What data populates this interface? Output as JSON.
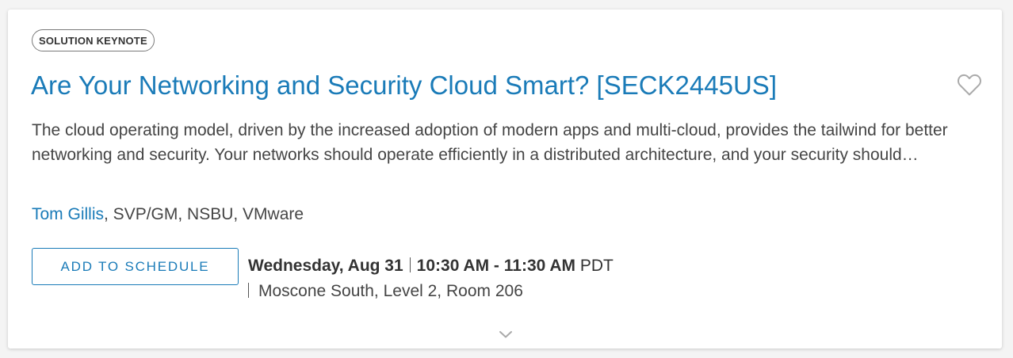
{
  "session": {
    "type_badge": "SOLUTION KEYNOTE",
    "title": "Are Your Networking and Security Cloud Smart? [SECK2445US]",
    "description": "The cloud operating model, driven by the increased adoption of modern apps and multi-cloud, provides the tailwind for better networking and security. Your networks should operate efficiently in a distributed architecture, and your security should…",
    "speaker": {
      "name": "Tom Gillis",
      "details": ", SVP/GM, NSBU, VMware"
    },
    "schedule": {
      "day": "Wednesday, Aug 31",
      "time_bold": "10:30 AM - 11:30 AM",
      "timezone": "PDT",
      "location": "Moscone South, Level 2, Room 206"
    },
    "add_button_label": "ADD TO SCHEDULE"
  },
  "icons": {
    "favorite": "heart-outline-icon",
    "expand": "chevron-down-icon"
  },
  "colors": {
    "accent": "#1a7bb8",
    "text": "#454545",
    "icon_gray": "#aaaaaa"
  }
}
